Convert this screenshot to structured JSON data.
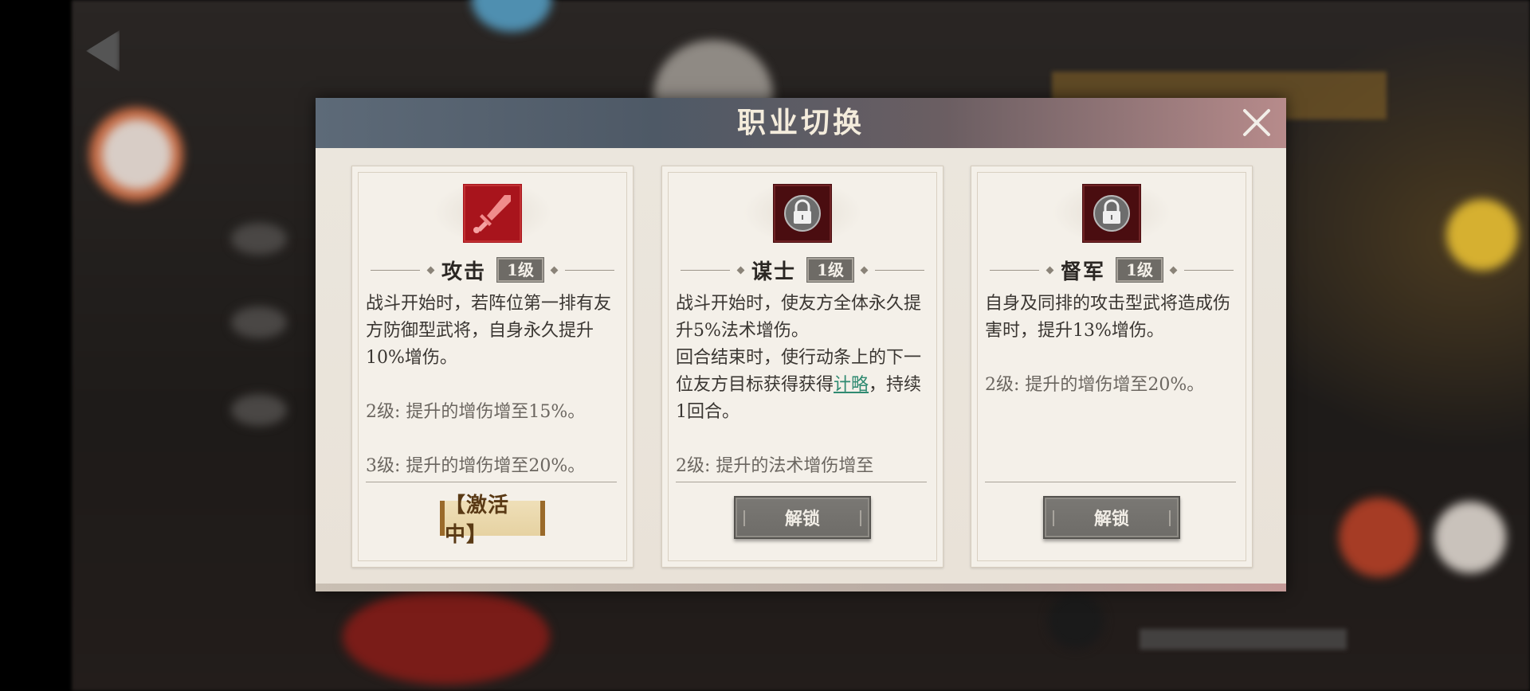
{
  "dialog": {
    "title": "职业切换"
  },
  "cards": [
    {
      "name": "攻击",
      "level": "1级",
      "icon": "sword-icon",
      "desc": [
        "战斗开始时，若阵位第一排有友方防御型武将，自身永久提升10%增伤。",
        "2级: 提升的增伤增至15%。",
        "3级: 提升的增伤增至20%。"
      ],
      "action": "【激活中】"
    },
    {
      "name": "谋士",
      "level": "1级",
      "icon": "lock-icon",
      "desc_a": "战斗开始时，使友方全体永久提升5%法术增伤。",
      "desc_b": "回合结束时，使行动条上的下一位友方目标获得获得",
      "desc_link": "计略",
      "desc_c": "，持续1回合。",
      "desc_d": "2级: 提升的法术增伤增至",
      "action": "解锁"
    },
    {
      "name": "督军",
      "level": "1级",
      "icon": "lock-icon",
      "desc": [
        "自身及同排的攻击型武将造成伤害时，提升13%增伤。",
        "2级: 提升的增伤增至20%。"
      ],
      "action": "解锁"
    }
  ],
  "colors": {
    "header_left": "#5d6a78",
    "header_right": "#b78b8b",
    "panel_bg": "#e8e2d8",
    "attack_icon": "#a8141c",
    "locked_icon": "#4a0d10",
    "link": "#2f8a71",
    "active_badge": "#e6d2a2"
  }
}
